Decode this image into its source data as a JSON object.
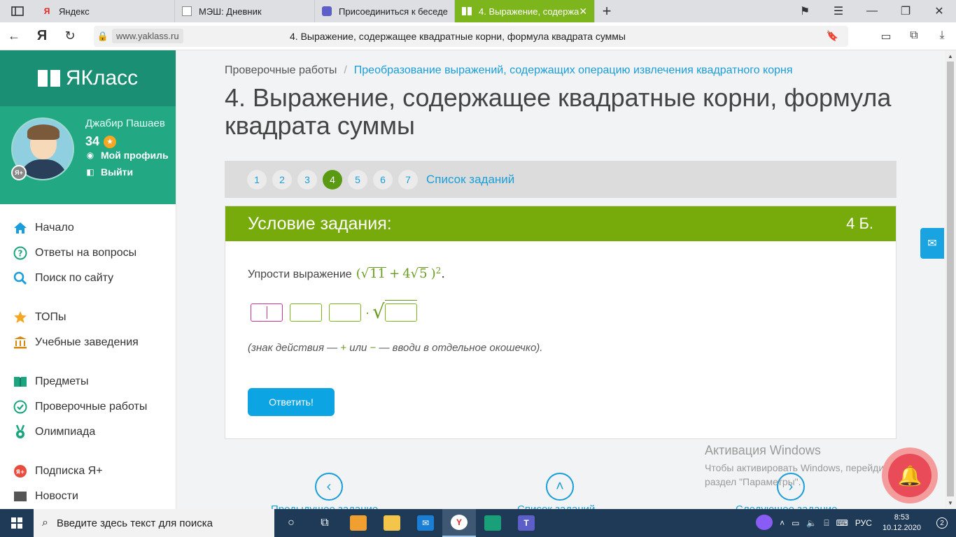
{
  "browser": {
    "tabs": [
      {
        "label": "Яндекс",
        "favicon": "Я",
        "active": false
      },
      {
        "label": "МЭШ: Дневник",
        "favicon": "",
        "active": false
      },
      {
        "label": "Присоединиться к беседе",
        "favicon": "",
        "active": false
      },
      {
        "label": "4. Выражение, содержа",
        "favicon": "",
        "active": true
      }
    ],
    "yandex_logo": "Я",
    "url_domain": "www.yaklass.ru",
    "url_title": "4. Выражение, содержащее квадратные корни, формула квадрата суммы"
  },
  "sidebar": {
    "logo_text": "ЯКласс",
    "user": {
      "name": "Джабир Пашаев",
      "points": "34",
      "yplus_badge": "Я+",
      "profile_link": "Мой профиль",
      "logout_link": "Выйти"
    },
    "menu": [
      {
        "label": "Начало",
        "icon": "home-icon"
      },
      {
        "label": "Ответы на вопросы",
        "icon": "question-icon"
      },
      {
        "label": "Поиск по сайту",
        "icon": "search-icon"
      },
      {
        "label": "ТОПы",
        "icon": "star-icon"
      },
      {
        "label": "Учебные заведения",
        "icon": "school-icon"
      },
      {
        "label": "Предметы",
        "icon": "books-icon"
      },
      {
        "label": "Проверочные работы",
        "icon": "check-icon"
      },
      {
        "label": "Олимпиада",
        "icon": "medal-icon"
      },
      {
        "label": "Подписка Я+",
        "icon": "subscription-icon"
      },
      {
        "label": "Новости",
        "icon": "news-icon"
      }
    ]
  },
  "main": {
    "breadcrumb": {
      "root": "Проверочные работы",
      "separator": "/",
      "current": "Преобразование выражений, содержащих операцию извлечения квадратного корня"
    },
    "title": "4. Выражение, содержащее квадратные корни, формула квадрата суммы",
    "pager": {
      "pages": [
        "1",
        "2",
        "3",
        "4",
        "5",
        "6",
        "7"
      ],
      "current": "4",
      "list_link": "Список заданий"
    },
    "task": {
      "header": "Условие задания:",
      "points": "4 Б.",
      "prompt": "Упрости выражение",
      "expr": {
        "open": "(",
        "rad1": "11",
        "plus": "+",
        "coef": "4",
        "rad2": "5",
        "close": ")",
        "power": "2",
        "end": "."
      },
      "hint_before": "(знак действия — ",
      "hint_plus": "+",
      "hint_or": " или ",
      "hint_minus": "−",
      "hint_after": " — вводи в отдельное окошечко).",
      "dot": "·",
      "submit": "Ответить!"
    },
    "bottom_nav": {
      "prev": "Предыдущее задание",
      "list": "Список заданий",
      "next": "Следующее задание"
    }
  },
  "overlay": {
    "activation_title": "Активация Windows",
    "activation_text": "Чтобы активировать Windows, перейдите в раздел \"Параметры\"."
  },
  "taskbar": {
    "search_placeholder": "Введите здесь текст для поиска",
    "lang": "РУС",
    "time": "8:53",
    "date": "10.12.2020",
    "notifications": "2"
  },
  "colors": {
    "brand_green": "#77ab0c",
    "sidebar_teal": "#22a883",
    "link_blue": "#1a9ed9",
    "button_blue": "#0da4e4"
  }
}
